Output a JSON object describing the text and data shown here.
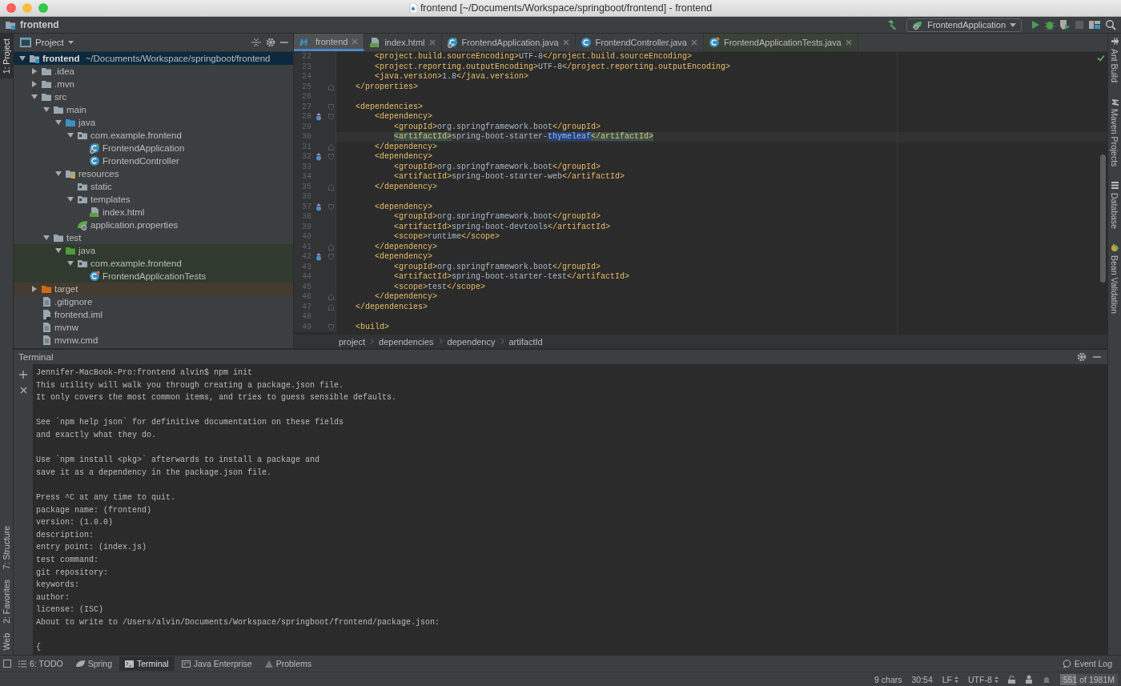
{
  "window": {
    "title": "frontend [~/Documents/Workspace/springboot/frontend] - frontend"
  },
  "navbar": {
    "breadcrumb": "frontend",
    "run_config": "FrontendApplication"
  },
  "left_tool_tabs": [
    {
      "label": "1: Project",
      "selected": true,
      "kind": "top"
    },
    {
      "label": "7: Structure",
      "selected": false,
      "kind": "bottom"
    },
    {
      "label": "2: Favorites",
      "selected": false,
      "kind": "bottom"
    },
    {
      "label": "Web",
      "selected": false,
      "kind": "bottom"
    }
  ],
  "right_tool_tabs": [
    {
      "label": "Ant Build",
      "kind": "ant"
    },
    {
      "label": "Maven Projects",
      "kind": "maven"
    },
    {
      "label": "Database",
      "kind": "database"
    },
    {
      "label": "Bean Validation",
      "kind": "bean"
    }
  ],
  "project_panel": {
    "title": "Project",
    "tree": [
      {
        "name": "frontend",
        "path": "~/Documents/Workspace/springboot/frontend",
        "kind": "module",
        "expanded": true,
        "selected": true,
        "children": [
          {
            "name": ".idea",
            "kind": "folder",
            "expanded": false,
            "selected": false
          },
          {
            "name": ".mvn",
            "kind": "folder",
            "expanded": false,
            "selected": false
          },
          {
            "name": "src",
            "kind": "folder",
            "expanded": true,
            "selected": false,
            "children": [
              {
                "name": "main",
                "kind": "folder",
                "expanded": true,
                "selected": false,
                "children": [
                  {
                    "name": "java",
                    "kind": "source-folder",
                    "expanded": true,
                    "selected": false,
                    "children": [
                      {
                        "name": "com.example.frontend",
                        "kind": "package",
                        "expanded": true,
                        "selected": false,
                        "children": [
                          {
                            "name": "FrontendApplication",
                            "kind": "spring-class",
                            "selected": false
                          },
                          {
                            "name": "FrontendController",
                            "kind": "class",
                            "selected": false
                          }
                        ]
                      }
                    ]
                  },
                  {
                    "name": "resources",
                    "kind": "resources-folder",
                    "expanded": true,
                    "selected": false,
                    "children": [
                      {
                        "name": "static",
                        "kind": "package",
                        "selected": false
                      },
                      {
                        "name": "templates",
                        "kind": "package",
                        "expanded": true,
                        "selected": false,
                        "children": [
                          {
                            "name": "index.html",
                            "kind": "html",
                            "selected": false
                          }
                        ]
                      },
                      {
                        "name": "application.properties",
                        "kind": "properties",
                        "selected": false
                      }
                    ]
                  }
                ]
              },
              {
                "name": "test",
                "kind": "folder",
                "expanded": true,
                "selected": false,
                "children": [
                  {
                    "name": "java",
                    "kind": "test-folder",
                    "expanded": true,
                    "selected": false,
                    "children": [
                      {
                        "name": "com.example.frontend",
                        "kind": "package",
                        "expanded": true,
                        "selected": false,
                        "children": [
                          {
                            "name": "FrontendApplicationTests",
                            "kind": "test-class",
                            "selected": false
                          }
                        ]
                      }
                    ]
                  }
                ]
              }
            ]
          },
          {
            "name": "target",
            "kind": "excluded-folder",
            "expanded": false,
            "selected": false
          },
          {
            "name": ".gitignore",
            "kind": "file",
            "selected": false
          },
          {
            "name": "frontend.iml",
            "kind": "iml",
            "selected": false
          },
          {
            "name": "mvnw",
            "kind": "file",
            "selected": false
          },
          {
            "name": "mvnw.cmd",
            "kind": "file",
            "selected": false
          }
        ]
      }
    ]
  },
  "editor": {
    "tabs": [
      {
        "label": "frontend",
        "kind": "maven",
        "selected": true
      },
      {
        "label": "index.html",
        "kind": "html",
        "selected": false
      },
      {
        "label": "FrontendApplication.java",
        "kind": "spring-class",
        "selected": false
      },
      {
        "label": "FrontendController.java",
        "kind": "class",
        "selected": false
      },
      {
        "label": "FrontendApplicationTests.java",
        "kind": "test-class",
        "selected": false
      }
    ],
    "lines": [
      {
        "number": "22",
        "code": "        <project.build.sourceEncoding>UTF-8</project.build.sourceEncoding>",
        "marker": false,
        "current": false
      },
      {
        "number": "23",
        "code": "        <project.reporting.outputEncoding>UTF-8</project.reporting.outputEncoding>",
        "marker": false,
        "current": false
      },
      {
        "number": "24",
        "code": "        <java.version>1.8</java.version>",
        "marker": false,
        "current": false
      },
      {
        "number": "25",
        "code": "    </properties>",
        "marker": false,
        "current": false,
        "kind": "fold-end"
      },
      {
        "number": "26",
        "marker": false,
        "current": false
      },
      {
        "number": "27",
        "code": "    <dependencies>",
        "marker": false,
        "current": false,
        "kind": "fold-start"
      },
      {
        "number": "28",
        "code": "        <dependency>",
        "marker": true,
        "current": false,
        "kind": "fold-start"
      },
      {
        "number": "29",
        "code": "            <groupId>org.springframework.boot</groupId>",
        "marker": false,
        "current": false
      },
      {
        "number": "30",
        "code": "            <artifactId>spring-boot-starter-",
        "selection": "thymeleaf",
        "code_after": "</artifactId>",
        "marker": false,
        "current": true
      },
      {
        "number": "31",
        "code": "        </dependency>",
        "marker": false,
        "current": false,
        "kind": "fold-end"
      },
      {
        "number": "32",
        "code": "        <dependency>",
        "marker": true,
        "current": false,
        "kind": "fold-start"
      },
      {
        "number": "33",
        "code": "            <groupId>org.springframework.boot</groupId>",
        "marker": false,
        "current": false
      },
      {
        "number": "34",
        "code": "            <artifactId>spring-boot-starter-web</artifactId>",
        "marker": false,
        "current": false
      },
      {
        "number": "35",
        "code": "        </dependency>",
        "marker": false,
        "current": false,
        "kind": "fold-end"
      },
      {
        "number": "36",
        "marker": false,
        "current": false
      },
      {
        "number": "37",
        "code": "        <dependency>",
        "marker": true,
        "current": false,
        "kind": "fold-start"
      },
      {
        "number": "38",
        "code": "            <groupId>org.springframework.boot</groupId>",
        "marker": false,
        "current": false
      },
      {
        "number": "39",
        "code": "            <artifactId>spring-boot-devtools</artifactId>",
        "marker": false,
        "current": false
      },
      {
        "number": "40",
        "code": "            <scope>runtime</scope>",
        "marker": false,
        "current": false
      },
      {
        "number": "41",
        "code": "        </dependency>",
        "marker": false,
        "current": false,
        "kind": "fold-end"
      },
      {
        "number": "42",
        "code": "        <dependency>",
        "marker": true,
        "current": false,
        "kind": "fold-start"
      },
      {
        "number": "43",
        "code": "            <groupId>org.springframework.boot</groupId>",
        "marker": false,
        "current": false
      },
      {
        "number": "44",
        "code": "            <artifactId>spring-boot-starter-test</artifactId>",
        "marker": false,
        "current": false
      },
      {
        "number": "45",
        "code": "            <scope>test</scope>",
        "marker": false,
        "current": false
      },
      {
        "number": "46",
        "code": "        </dependency>",
        "marker": false,
        "current": false,
        "kind": "fold-end"
      },
      {
        "number": "47",
        "code": "    </dependencies>",
        "marker": false,
        "current": false,
        "kind": "fold-end"
      },
      {
        "number": "48",
        "marker": false,
        "current": false
      },
      {
        "number": "49",
        "code": "    <build>",
        "marker": false,
        "current": false,
        "kind": "fold-start"
      }
    ],
    "breadcrumb": [
      "project",
      "dependencies",
      "dependency",
      "artifactId"
    ]
  },
  "terminal": {
    "title": "Terminal",
    "paragraphs": [
      [
        "Jennifer-MacBook-Pro:frontend alvin$ npm init",
        "This utility will walk you through creating a package.json file.",
        "It only covers the most common items, and tries to guess sensible defaults."
      ],
      [
        "See `npm help json` for definitive documentation on these fields",
        "and exactly what they do."
      ],
      [
        "Use `npm install <pkg>` afterwards to install a package and",
        "save it as a dependency in the package.json file."
      ],
      [
        "Press ^C at any time to quit.",
        "package name: (frontend)",
        "version: (1.0.0)",
        "description:",
        "entry point: (index.js)",
        "test command:",
        "git repository:",
        "keywords:",
        "author:",
        "license: (ISC)",
        "About to write to /Users/alvin/Documents/Workspace/springboot/frontend/package.json:"
      ],
      [
        "{"
      ]
    ]
  },
  "bottom_tabs": [
    {
      "label": "6: TODO",
      "kind": "todo",
      "selected": false
    },
    {
      "label": "Spring",
      "kind": "spring",
      "selected": false
    },
    {
      "label": "Terminal",
      "kind": "terminal",
      "selected": true
    },
    {
      "label": "Java Enterprise",
      "kind": "javaee",
      "selected": false
    },
    {
      "label": "Problems",
      "kind": "problems",
      "selected": false
    }
  ],
  "event_log": "Event Log",
  "status_bar": {
    "selection": "9 chars",
    "position": "30:54",
    "line_separator": "LF",
    "encoding": "UTF-8",
    "memory": {
      "text": "551 of 1981M",
      "level": 0.28
    }
  }
}
